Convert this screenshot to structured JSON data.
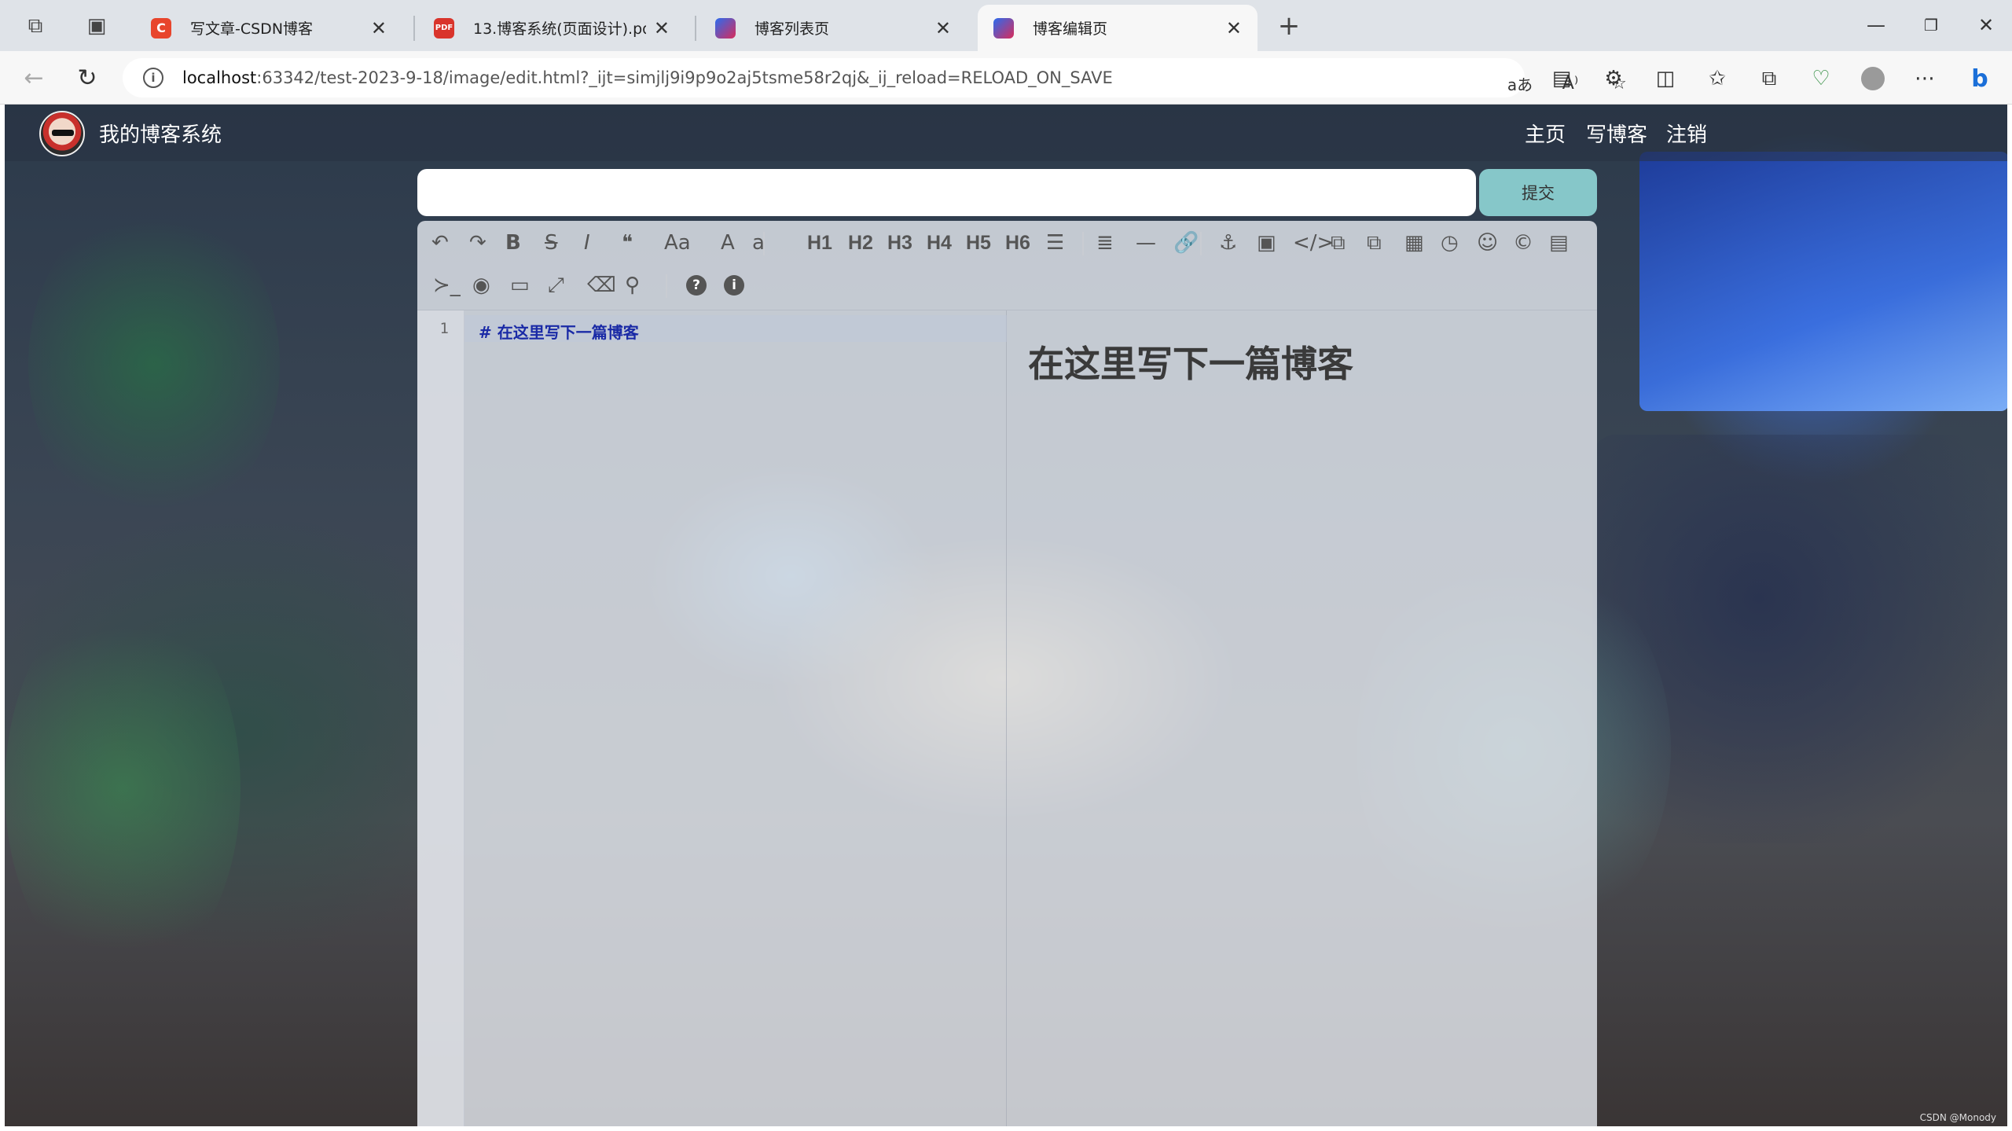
{
  "browser": {
    "tabs": [
      {
        "title": "写文章-CSDN博客",
        "icon": "csdn-icon",
        "icon_color": "#e8452c",
        "active": false
      },
      {
        "title": "13.博客系统(页面设计).pdf",
        "icon": "pdf-icon",
        "icon_color": "#d9342b",
        "active": false
      },
      {
        "title": "博客列表页",
        "icon": "jetbrains-icon",
        "icon_color": "#d92b5a",
        "active": false
      },
      {
        "title": "博客编辑页",
        "icon": "jetbrains-icon",
        "icon_color": "#d92b5a",
        "active": true
      }
    ],
    "url_host": "localhost",
    "url_rest": ":63342/test-2023-9-18/image/edit.html?_ijt=simjlj9i9p9o2aj5tsme58r2qj&_ij_reload=RELOAD_ON_SAVE"
  },
  "site": {
    "title": "我的博客系统",
    "nav": [
      "主页",
      "写博客",
      "注销"
    ]
  },
  "editor": {
    "title_value": "",
    "submit_label": "提交",
    "toolbar_row1": [
      {
        "name": "undo-icon",
        "glyph": "↶"
      },
      {
        "name": "redo-icon",
        "glyph": "↷"
      },
      {
        "name": "bold-icon",
        "glyph": "B"
      },
      {
        "name": "strikethrough-icon",
        "glyph": "S"
      },
      {
        "name": "italic-icon",
        "glyph": "I"
      },
      {
        "name": "quote-icon",
        "glyph": "❝"
      },
      {
        "name": "uppercase-icon",
        "glyph": "Aa"
      },
      {
        "name": "uppercase-a-icon",
        "glyph": "A"
      },
      {
        "name": "lowercase-icon",
        "glyph": "a"
      },
      {
        "name": "heading-1",
        "glyph": "H1"
      },
      {
        "name": "heading-2",
        "glyph": "H2"
      },
      {
        "name": "heading-3",
        "glyph": "H3"
      },
      {
        "name": "heading-4",
        "glyph": "H4"
      },
      {
        "name": "heading-5",
        "glyph": "H5"
      },
      {
        "name": "heading-6",
        "glyph": "H6"
      },
      {
        "name": "unordered-list-icon",
        "glyph": "☰"
      },
      {
        "name": "ordered-list-icon",
        "glyph": "≣"
      },
      {
        "name": "horizontal-rule-icon",
        "glyph": "—"
      },
      {
        "name": "link-icon",
        "glyph": "🔗"
      },
      {
        "name": "anchor-icon",
        "glyph": "⚓"
      },
      {
        "name": "image-icon",
        "glyph": "▣"
      },
      {
        "name": "code-icon",
        "glyph": "</>"
      },
      {
        "name": "code-block-icon",
        "glyph": "⧉"
      },
      {
        "name": "preformatted-icon",
        "glyph": "⧉"
      },
      {
        "name": "table-icon",
        "glyph": "▦"
      },
      {
        "name": "datetime-icon",
        "glyph": "◷"
      },
      {
        "name": "emoji-icon",
        "glyph": "☺"
      },
      {
        "name": "html-entities-icon",
        "glyph": "©"
      },
      {
        "name": "pagebreak-icon",
        "glyph": "▤"
      }
    ],
    "toolbar_row2": [
      {
        "name": "goto-line-icon",
        "glyph": "≻_"
      },
      {
        "name": "watch-icon",
        "glyph": "◉"
      },
      {
        "name": "preview-icon",
        "glyph": "▭"
      },
      {
        "name": "fullscreen-icon",
        "glyph": "⤢"
      },
      {
        "name": "clear-icon",
        "glyph": "⌫"
      },
      {
        "name": "search-icon",
        "glyph": "⚲"
      },
      {
        "name": "help-icon",
        "glyph": "?"
      },
      {
        "name": "info-icon",
        "glyph": "i"
      }
    ],
    "line_number": "1",
    "markdown": "# 在这里写下一篇博客",
    "preview_heading": "在这里写下一篇博客"
  },
  "watermark": "CSDN @Monody"
}
